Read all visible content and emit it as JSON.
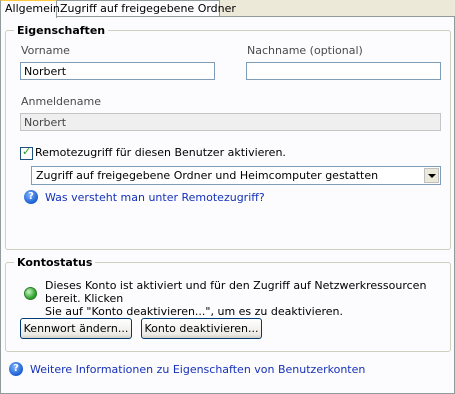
{
  "tabs": [
    {
      "label": "Allgemein"
    },
    {
      "label": "Zugriff auf freigegebene Ordner"
    }
  ],
  "properties": {
    "legend": "Eigenschaften",
    "first_name_label": "Vorname",
    "first_name_value": "Norbert",
    "last_name_label": "Nachname (optional)",
    "last_name_value": "",
    "logon_label": "Anmeldename",
    "logon_value": "Norbert",
    "remote_checkbox_label": "Remotezugriff für diesen Benutzer aktivieren.",
    "remote_checkbox_checked": true,
    "access_select_value": "Zugriff auf freigegebene Ordner und Heimcomputer gestatten",
    "help_link": "Was versteht man unter Remotezugriff?"
  },
  "account_status": {
    "legend": "Kontostatus",
    "status_line1": "Dieses Konto ist aktiviert und für den Zugriff auf Netzwerkressourcen bereit. Klicken",
    "status_line2": "Sie auf \"Konto deaktivieren...\", um es zu deaktivieren.",
    "change_password_button": "Kennwort ändern...",
    "deactivate_button": "Konto deaktivieren..."
  },
  "footer_link": "Weitere Informationen zu Eigenschaften von Benutzerkonten",
  "icons": {
    "help": "help-circle-icon",
    "status": "status-ok-icon"
  }
}
